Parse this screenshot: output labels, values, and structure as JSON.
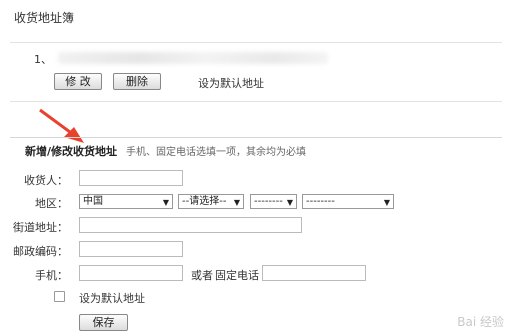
{
  "page": {
    "title": "收货地址簿"
  },
  "address_list": {
    "items": [
      {
        "index": "1、",
        "edit_label": "修 改",
        "delete_label": "删除",
        "set_default_label": "设为默认地址"
      }
    ]
  },
  "form": {
    "section_title": "新增/修改收货地址",
    "section_hint": "手机、固定电话选填一项，其余均为必填",
    "receiver": {
      "label": "收货人：",
      "value": ""
    },
    "region": {
      "label": "地区：",
      "country": "中国",
      "province": "--请选择--",
      "city": "--------",
      "district": "--------"
    },
    "street": {
      "label": "街道地址：",
      "value": ""
    },
    "postcode": {
      "label": "邮政编码：",
      "value": ""
    },
    "mobile": {
      "label": "手机：",
      "value": ""
    },
    "or_text": "或者",
    "phone": {
      "label": "固定电话",
      "value": ""
    },
    "default_checkbox": {
      "label": "设为默认地址",
      "checked": false
    },
    "save_label": "保存"
  },
  "watermark": {
    "text": "Bai 经验"
  },
  "colors": {
    "arrow": "#e8412c",
    "border": "#bbbbbb"
  }
}
